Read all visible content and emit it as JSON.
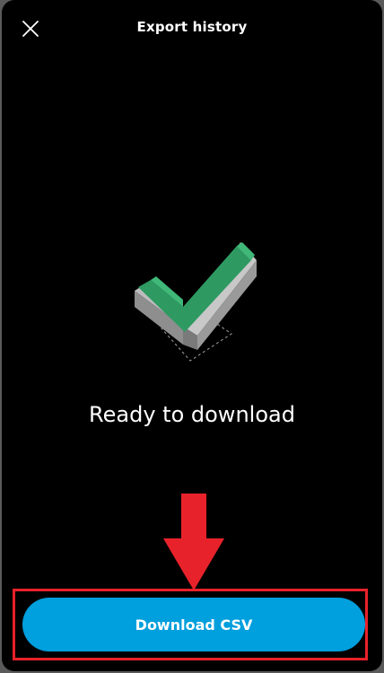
{
  "header": {
    "title": "Export history",
    "close_icon": "close-icon"
  },
  "main": {
    "illustration_icon": "checkmark-icon",
    "status_text": "Ready to download"
  },
  "annotation": {
    "arrow_icon": "arrow-down-icon",
    "arrow_color": "#e8222a",
    "highlight_color": "#e8222a"
  },
  "actions": {
    "download_label": "Download CSV",
    "download_color": "#009fdd"
  },
  "colors": {
    "background": "#000000",
    "text": "#ffffff"
  }
}
